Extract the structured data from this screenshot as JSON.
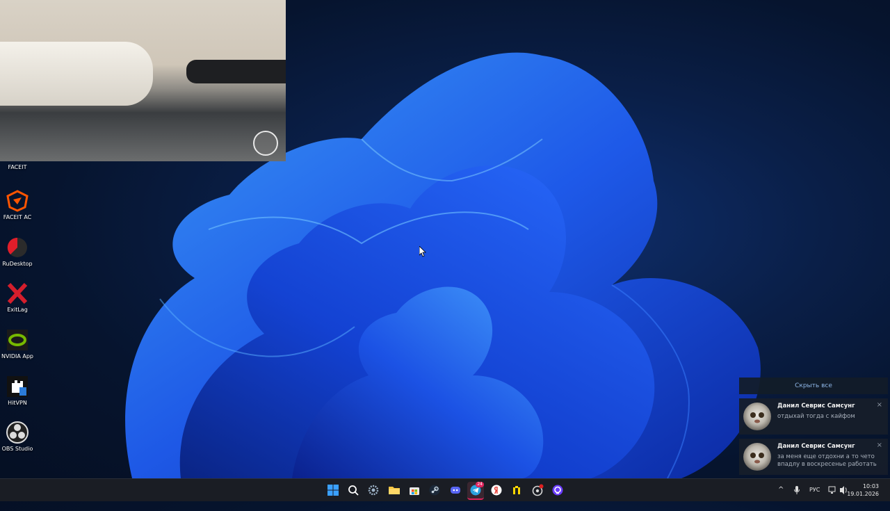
{
  "desktop_icons": [
    {
      "label": "FACEIT",
      "icon": "faceit-icon"
    },
    {
      "label": "FACEIT AC",
      "icon": "faceit-ac-icon"
    },
    {
      "label": "RuDesktop",
      "icon": "rudesktop-icon"
    },
    {
      "label": "ExitLag",
      "icon": "exitlag-icon"
    },
    {
      "label": "NVIDIA App",
      "icon": "nvidia-icon"
    },
    {
      "label": "HitVPN",
      "icon": "hitvpn-icon"
    },
    {
      "label": "OBS Studio",
      "icon": "obs-icon"
    }
  ],
  "notifications": {
    "hide_all_label": "Скрыть все",
    "items": [
      {
        "sender": "Данил Севрис Самсунг",
        "message": "отдыхай тогда с кайфом"
      },
      {
        "sender": "Данил Севрис Самсунг",
        "message": "за меня еще отдохни а то чето впадлу в воскресенье работать"
      }
    ]
  },
  "taskbar": {
    "pinned": [
      {
        "name": "start-button",
        "icon": "windows-icon"
      },
      {
        "name": "search-button",
        "icon": "search-icon"
      },
      {
        "name": "settings-app",
        "icon": "gear-icon"
      },
      {
        "name": "file-explorer-app",
        "icon": "folder-icon"
      },
      {
        "name": "store-app",
        "icon": "store-icon"
      },
      {
        "name": "steam-app",
        "icon": "steam-icon"
      },
      {
        "name": "discord-app",
        "icon": "discord-icon"
      },
      {
        "name": "telegram-app",
        "icon": "telegram-icon",
        "badge": "24"
      },
      {
        "name": "yandex-browser-app",
        "icon": "yandex-icon"
      },
      {
        "name": "app-yellow",
        "icon": "yellow-app-icon"
      },
      {
        "name": "app-gear-red",
        "icon": "notification-app-icon"
      },
      {
        "name": "alice-app",
        "icon": "alice-icon"
      }
    ],
    "tray": {
      "language": "РУС",
      "time": "10:03",
      "date": "19.01.2026"
    }
  },
  "colors": {
    "wallpaper_accent": "#1f5cf0",
    "taskbar_bg": "#1a1d24",
    "notif_link": "#8fb7e8",
    "telegram_badge": "#e0245e"
  }
}
